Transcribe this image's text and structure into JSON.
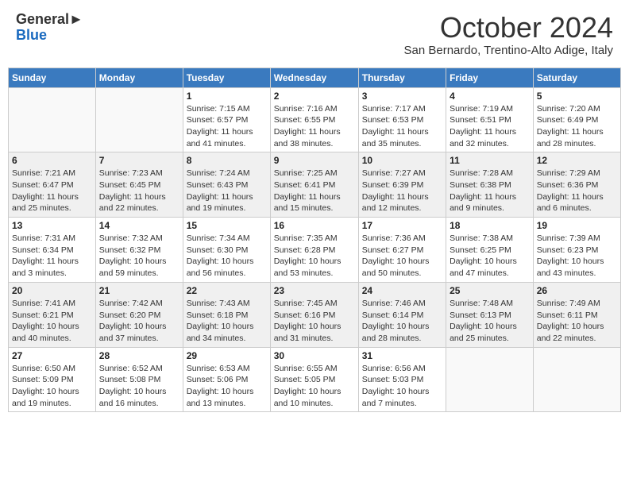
{
  "header": {
    "logo_general": "General",
    "logo_blue": "Blue",
    "month_title": "October 2024",
    "subtitle": "San Bernardo, Trentino-Alto Adige, Italy"
  },
  "days_of_week": [
    "Sunday",
    "Monday",
    "Tuesday",
    "Wednesday",
    "Thursday",
    "Friday",
    "Saturday"
  ],
  "weeks": [
    [
      {
        "day": "",
        "sunrise": "",
        "sunset": "",
        "daylight": "",
        "empty": true
      },
      {
        "day": "",
        "sunrise": "",
        "sunset": "",
        "daylight": "",
        "empty": true
      },
      {
        "day": "1",
        "sunrise": "Sunrise: 7:15 AM",
        "sunset": "Sunset: 6:57 PM",
        "daylight": "Daylight: 11 hours and 41 minutes."
      },
      {
        "day": "2",
        "sunrise": "Sunrise: 7:16 AM",
        "sunset": "Sunset: 6:55 PM",
        "daylight": "Daylight: 11 hours and 38 minutes."
      },
      {
        "day": "3",
        "sunrise": "Sunrise: 7:17 AM",
        "sunset": "Sunset: 6:53 PM",
        "daylight": "Daylight: 11 hours and 35 minutes."
      },
      {
        "day": "4",
        "sunrise": "Sunrise: 7:19 AM",
        "sunset": "Sunset: 6:51 PM",
        "daylight": "Daylight: 11 hours and 32 minutes."
      },
      {
        "day": "5",
        "sunrise": "Sunrise: 7:20 AM",
        "sunset": "Sunset: 6:49 PM",
        "daylight": "Daylight: 11 hours and 28 minutes."
      }
    ],
    [
      {
        "day": "6",
        "sunrise": "Sunrise: 7:21 AM",
        "sunset": "Sunset: 6:47 PM",
        "daylight": "Daylight: 11 hours and 25 minutes."
      },
      {
        "day": "7",
        "sunrise": "Sunrise: 7:23 AM",
        "sunset": "Sunset: 6:45 PM",
        "daylight": "Daylight: 11 hours and 22 minutes."
      },
      {
        "day": "8",
        "sunrise": "Sunrise: 7:24 AM",
        "sunset": "Sunset: 6:43 PM",
        "daylight": "Daylight: 11 hours and 19 minutes."
      },
      {
        "day": "9",
        "sunrise": "Sunrise: 7:25 AM",
        "sunset": "Sunset: 6:41 PM",
        "daylight": "Daylight: 11 hours and 15 minutes."
      },
      {
        "day": "10",
        "sunrise": "Sunrise: 7:27 AM",
        "sunset": "Sunset: 6:39 PM",
        "daylight": "Daylight: 11 hours and 12 minutes."
      },
      {
        "day": "11",
        "sunrise": "Sunrise: 7:28 AM",
        "sunset": "Sunset: 6:38 PM",
        "daylight": "Daylight: 11 hours and 9 minutes."
      },
      {
        "day": "12",
        "sunrise": "Sunrise: 7:29 AM",
        "sunset": "Sunset: 6:36 PM",
        "daylight": "Daylight: 11 hours and 6 minutes."
      }
    ],
    [
      {
        "day": "13",
        "sunrise": "Sunrise: 7:31 AM",
        "sunset": "Sunset: 6:34 PM",
        "daylight": "Daylight: 11 hours and 3 minutes."
      },
      {
        "day": "14",
        "sunrise": "Sunrise: 7:32 AM",
        "sunset": "Sunset: 6:32 PM",
        "daylight": "Daylight: 10 hours and 59 minutes."
      },
      {
        "day": "15",
        "sunrise": "Sunrise: 7:34 AM",
        "sunset": "Sunset: 6:30 PM",
        "daylight": "Daylight: 10 hours and 56 minutes."
      },
      {
        "day": "16",
        "sunrise": "Sunrise: 7:35 AM",
        "sunset": "Sunset: 6:28 PM",
        "daylight": "Daylight: 10 hours and 53 minutes."
      },
      {
        "day": "17",
        "sunrise": "Sunrise: 7:36 AM",
        "sunset": "Sunset: 6:27 PM",
        "daylight": "Daylight: 10 hours and 50 minutes."
      },
      {
        "day": "18",
        "sunrise": "Sunrise: 7:38 AM",
        "sunset": "Sunset: 6:25 PM",
        "daylight": "Daylight: 10 hours and 47 minutes."
      },
      {
        "day": "19",
        "sunrise": "Sunrise: 7:39 AM",
        "sunset": "Sunset: 6:23 PM",
        "daylight": "Daylight: 10 hours and 43 minutes."
      }
    ],
    [
      {
        "day": "20",
        "sunrise": "Sunrise: 7:41 AM",
        "sunset": "Sunset: 6:21 PM",
        "daylight": "Daylight: 10 hours and 40 minutes."
      },
      {
        "day": "21",
        "sunrise": "Sunrise: 7:42 AM",
        "sunset": "Sunset: 6:20 PM",
        "daylight": "Daylight: 10 hours and 37 minutes."
      },
      {
        "day": "22",
        "sunrise": "Sunrise: 7:43 AM",
        "sunset": "Sunset: 6:18 PM",
        "daylight": "Daylight: 10 hours and 34 minutes."
      },
      {
        "day": "23",
        "sunrise": "Sunrise: 7:45 AM",
        "sunset": "Sunset: 6:16 PM",
        "daylight": "Daylight: 10 hours and 31 minutes."
      },
      {
        "day": "24",
        "sunrise": "Sunrise: 7:46 AM",
        "sunset": "Sunset: 6:14 PM",
        "daylight": "Daylight: 10 hours and 28 minutes."
      },
      {
        "day": "25",
        "sunrise": "Sunrise: 7:48 AM",
        "sunset": "Sunset: 6:13 PM",
        "daylight": "Daylight: 10 hours and 25 minutes."
      },
      {
        "day": "26",
        "sunrise": "Sunrise: 7:49 AM",
        "sunset": "Sunset: 6:11 PM",
        "daylight": "Daylight: 10 hours and 22 minutes."
      }
    ],
    [
      {
        "day": "27",
        "sunrise": "Sunrise: 6:50 AM",
        "sunset": "Sunset: 5:09 PM",
        "daylight": "Daylight: 10 hours and 19 minutes."
      },
      {
        "day": "28",
        "sunrise": "Sunrise: 6:52 AM",
        "sunset": "Sunset: 5:08 PM",
        "daylight": "Daylight: 10 hours and 16 minutes."
      },
      {
        "day": "29",
        "sunrise": "Sunrise: 6:53 AM",
        "sunset": "Sunset: 5:06 PM",
        "daylight": "Daylight: 10 hours and 13 minutes."
      },
      {
        "day": "30",
        "sunrise": "Sunrise: 6:55 AM",
        "sunset": "Sunset: 5:05 PM",
        "daylight": "Daylight: 10 hours and 10 minutes."
      },
      {
        "day": "31",
        "sunrise": "Sunrise: 6:56 AM",
        "sunset": "Sunset: 5:03 PM",
        "daylight": "Daylight: 10 hours and 7 minutes."
      },
      {
        "day": "",
        "sunrise": "",
        "sunset": "",
        "daylight": "",
        "empty": true
      },
      {
        "day": "",
        "sunrise": "",
        "sunset": "",
        "daylight": "",
        "empty": true
      }
    ]
  ]
}
